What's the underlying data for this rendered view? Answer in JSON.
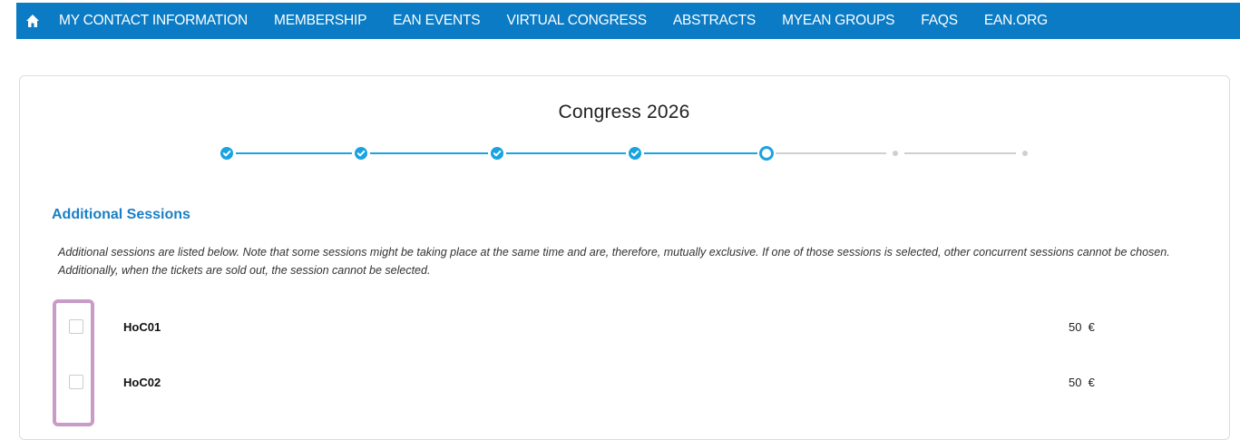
{
  "nav": {
    "home_icon": "home-icon",
    "items": [
      "MY CONTACT INFORMATION",
      "MEMBERSHIP",
      "EAN EVENTS",
      "VIRTUAL CONGRESS",
      "ABSTRACTS",
      "MYEAN GROUPS",
      "FAQS",
      "EAN.ORG"
    ]
  },
  "page": {
    "title": "Congress 2026"
  },
  "stepper": {
    "total_steps": 7,
    "completed_steps": 4,
    "current_step": 5,
    "colors": {
      "active": "#1aa3e0",
      "inactive": "#cfcfcf"
    }
  },
  "sessions_section": {
    "heading": "Additional Sessions",
    "description": "Additional sessions are listed below. Note that some sessions might be taking place at the same time and are, therefore, mutually exclusive. If one of those sessions is selected, other concurrent sessions cannot be chosen. Additionally, when the tickets are sold out, the session cannot be selected.",
    "items": [
      {
        "name": "HoC01",
        "price": "50  €",
        "checked": false
      },
      {
        "name": "HoC02",
        "price": "50  €",
        "checked": false
      }
    ]
  },
  "colors": {
    "nav_background": "#0a7bc4",
    "heading": "#1a7fc5",
    "highlight_border": "#c89bc8"
  }
}
